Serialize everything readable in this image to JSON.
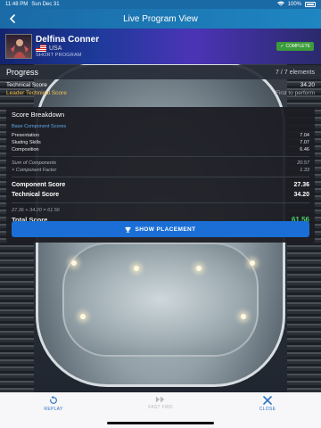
{
  "status_bar": {
    "time": "11:48 PM",
    "date": "Sun Dec 31",
    "battery": "100%"
  },
  "nav": {
    "title": "Live Program View"
  },
  "skater": {
    "name": "Delfina Conner",
    "country": "USA",
    "segment": "SHORT PROGRAM",
    "status_badge": "COMPLETE"
  },
  "progress": {
    "label": "Progress",
    "count": "7 / 7 elements"
  },
  "scores": {
    "technical": {
      "label": "Technical Score",
      "value": "34.20"
    },
    "leader": {
      "label": "Leader Technical Score",
      "value": "First to perform"
    }
  },
  "breakdown": {
    "title": "Score Breakdown",
    "section": "Base Component Scores",
    "components": [
      {
        "label": "Presentation",
        "value": "7.04"
      },
      {
        "label": "Skating Skills",
        "value": "7.07"
      },
      {
        "label": "Composition",
        "value": "6.46"
      }
    ],
    "sum": {
      "label": "Sum of Components",
      "value": "20.57"
    },
    "factor": {
      "label": "× Component Factor",
      "value": "1.33"
    },
    "component_score": {
      "label": "Component Score",
      "value": "27.36"
    },
    "technical_score": {
      "label": "Technical Score",
      "value": "34.20"
    },
    "formula": "27.36 + 34.20 = 61.56",
    "total": {
      "label": "Total Score",
      "value": "61.56"
    }
  },
  "show_placement": {
    "label": "SHOW PLACEMENT",
    "icon": "trophy-icon"
  },
  "bottom_bar": {
    "replay": "REPLAY",
    "fast_fwd": "FAST FWD",
    "close": "CLOSE"
  },
  "colors": {
    "accent": "#1a6ed6",
    "total": "#4bd36a",
    "leader": "#f2c14e"
  }
}
